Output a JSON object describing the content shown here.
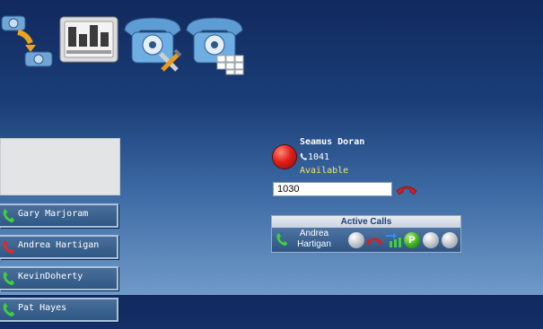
{
  "toolbar": {
    "icons": [
      "call-transfer-icon",
      "switchboard-icon",
      "phone-settings-icon",
      "phone-keypad-icon"
    ]
  },
  "contacts": [
    {
      "name": "Gary Marjoram",
      "phone_icon": "phone-green-icon",
      "color": "#3fcf3f"
    },
    {
      "name": "Andrea Hartigan",
      "phone_icon": "phone-red-icon",
      "color": "#e02a2a"
    },
    {
      "name": "KevinDoherty",
      "phone_icon": "phone-green-icon",
      "color": "#3fcf3f"
    },
    {
      "name": "Pat Hayes",
      "phone_icon": "phone-green-icon",
      "color": "#3fcf3f"
    }
  ],
  "user": {
    "name": "Seamus Doran",
    "extension": "1041",
    "status": "Available",
    "status_color": "#e0201a"
  },
  "dial": {
    "value": "1030",
    "hangup_icon": "hangup-red-icon"
  },
  "active_calls": {
    "title": "Active Calls",
    "calls": [
      {
        "name_line1": "Andrea",
        "name_line2": "Hartigan",
        "park_label": "P"
      }
    ]
  }
}
